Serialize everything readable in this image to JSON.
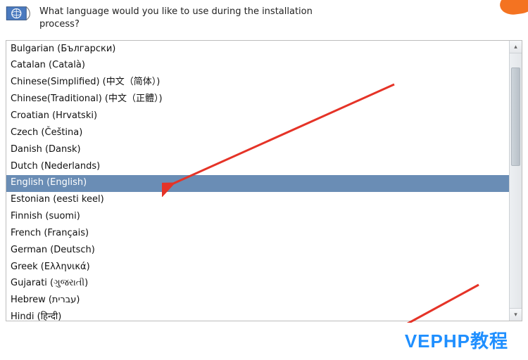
{
  "header": {
    "prompt": "What language would you like to use during the installation process?"
  },
  "languages": [
    {
      "label": "Bulgarian (Български)",
      "selected": false
    },
    {
      "label": "Catalan (Català)",
      "selected": false
    },
    {
      "label": "Chinese(Simplified) (中文（简体）)",
      "selected": false
    },
    {
      "label": "Chinese(Traditional) (中文（正體）)",
      "selected": false
    },
    {
      "label": "Croatian (Hrvatski)",
      "selected": false
    },
    {
      "label": "Czech (Čeština)",
      "selected": false
    },
    {
      "label": "Danish (Dansk)",
      "selected": false
    },
    {
      "label": "Dutch (Nederlands)",
      "selected": false
    },
    {
      "label": "English (English)",
      "selected": true
    },
    {
      "label": "Estonian (eesti keel)",
      "selected": false
    },
    {
      "label": "Finnish (suomi)",
      "selected": false
    },
    {
      "label": "French (Français)",
      "selected": false
    },
    {
      "label": "German (Deutsch)",
      "selected": false
    },
    {
      "label": "Greek (Ελληνικά)",
      "selected": false
    },
    {
      "label": "Gujarati (ગુજરાતી)",
      "selected": false
    },
    {
      "label": "Hebrew (עברית)",
      "selected": false
    },
    {
      "label": "Hindi (हिन्दी)",
      "selected": false
    }
  ],
  "watermark": "VEPHP教程",
  "colors": {
    "selected_bg": "#6a8db5",
    "accent_orange": "#f47321",
    "link_blue": "#1f8fff"
  }
}
